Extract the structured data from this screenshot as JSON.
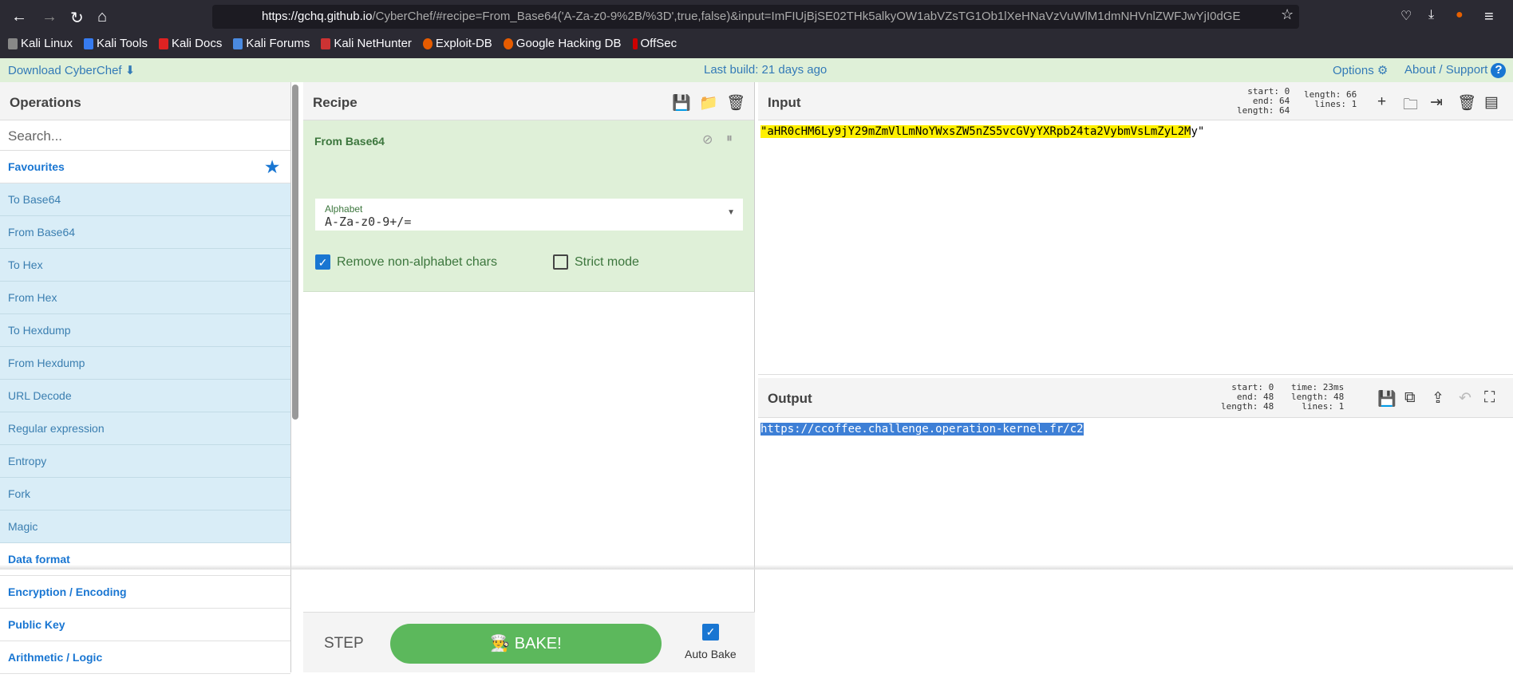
{
  "browser": {
    "url_host": "https://gchq.github.io",
    "url_rest": "/CyberChef/#recipe=From_Base64('A-Za-z0-9%2B/%3D',true,false)&input=ImFIUjBjSE02THk5alkyOW1abVZsTG1Ob1lXeHNaVzVuWlM1dmNHVnlZWFJwYjI0dGE",
    "bookmarks": [
      "Kali Linux",
      "Kali Tools",
      "Kali Docs",
      "Kali Forums",
      "Kali NetHunter",
      "Exploit-DB",
      "Google Hacking DB",
      "OffSec"
    ]
  },
  "banner": {
    "download": "Download CyberChef",
    "build": "Last build: 21 days ago",
    "options": "Options",
    "about": "About / Support"
  },
  "operations": {
    "title": "Operations",
    "search_placeholder": "Search...",
    "favourites": "Favourites",
    "items": [
      "To Base64",
      "From Base64",
      "To Hex",
      "From Hex",
      "To Hexdump",
      "From Hexdump",
      "URL Decode",
      "Regular expression",
      "Entropy",
      "Fork",
      "Magic"
    ],
    "categories": [
      "Data format",
      "Encryption / Encoding",
      "Public Key",
      "Arithmetic / Logic"
    ]
  },
  "recipe": {
    "title": "Recipe",
    "operation": "From Base64",
    "alphabet_label": "Alphabet",
    "alphabet_value": "A-Za-z0-9+/=",
    "remove_label": "Remove non-alphabet chars",
    "remove_checked": true,
    "strict_label": "Strict mode",
    "strict_checked": false,
    "step": "STEP",
    "bake": "BAKE!",
    "auto_bake": "Auto Bake",
    "auto_bake_checked": true
  },
  "input": {
    "title": "Input",
    "start": "start:  0",
    "end": "end: 64",
    "length": "length: 64",
    "length2": "length: 66",
    "lines": "lines:  1",
    "text_highlighted": "\"aHR0cHM6Ly9jY29mZmVlLmNoYWxsZW5nZS5vcGVyYXRpb24ta2VybmVsLmZyL2M",
    "text_rest": "y\""
  },
  "output": {
    "title": "Output",
    "start": "start:  0",
    "end": "end: 48",
    "length": "length: 48",
    "time": "time: 23ms",
    "length2": "length:   48",
    "lines": "lines:    1",
    "text": "https://ccoffee.challenge.operation-kernel.fr/c2"
  },
  "colors": {
    "banner": "#dff0d8",
    "bake": "#5cb85c",
    "highlight": "#fff000",
    "selection": "#3d7fd6"
  }
}
